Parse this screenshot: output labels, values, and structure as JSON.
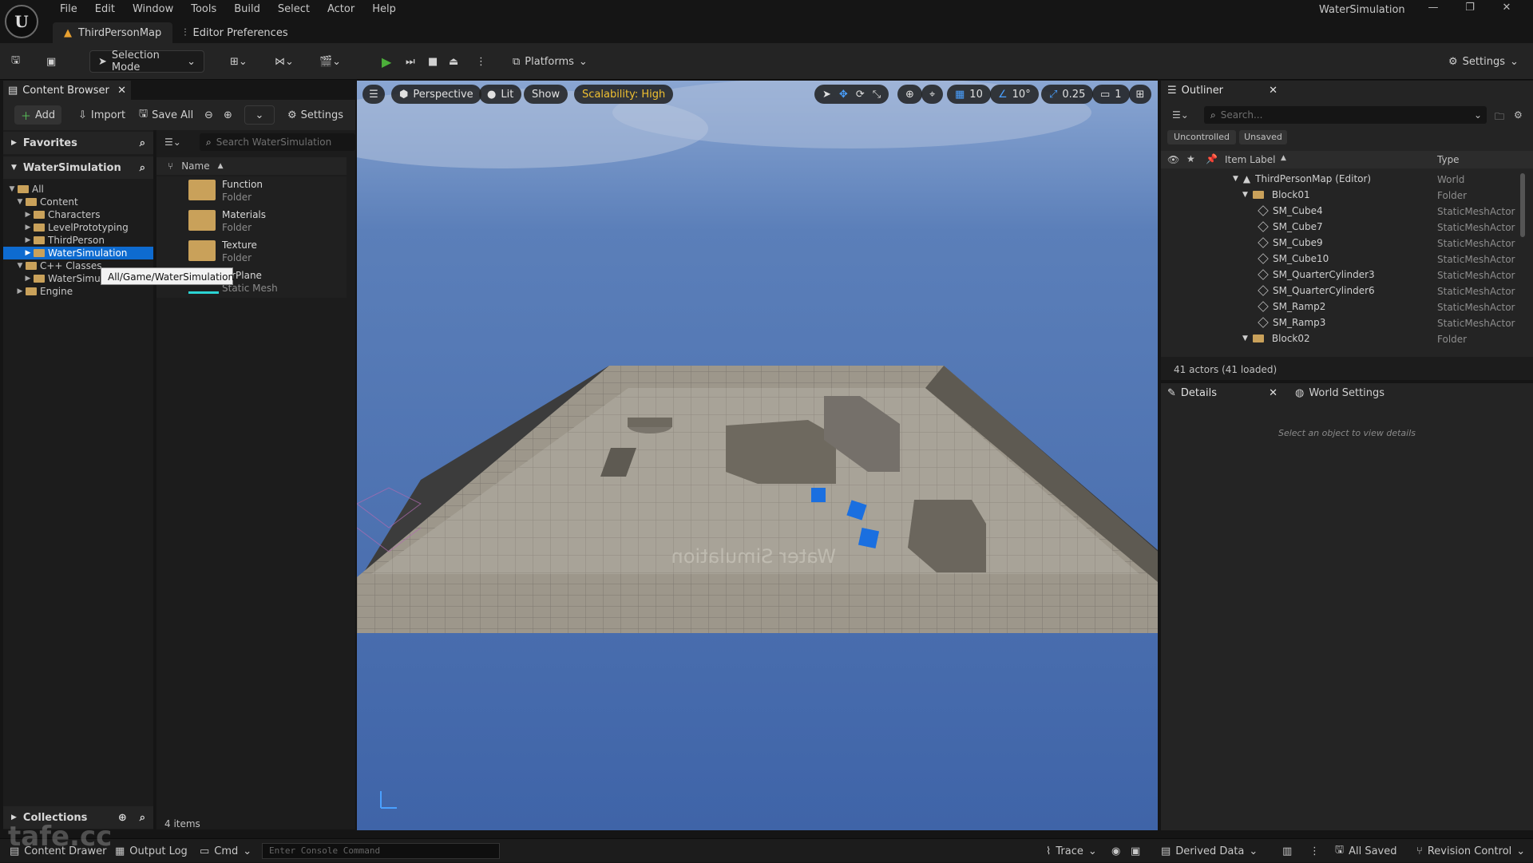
{
  "app": {
    "title": "WaterSimulation",
    "logo": "U"
  },
  "menu": [
    "File",
    "Edit",
    "Window",
    "Tools",
    "Build",
    "Select",
    "Actor",
    "Help"
  ],
  "tabs": [
    {
      "label": "ThirdPersonMap"
    },
    {
      "label": "Editor Preferences"
    }
  ],
  "toolbar": {
    "selection_mode": "Selection Mode",
    "platforms": "Platforms",
    "settings": "Settings"
  },
  "content_browser": {
    "tab_label": "Content Browser",
    "add": "Add",
    "import": "Import",
    "save_all": "Save All",
    "settings": "Settings",
    "favorites": "Favorites",
    "root": "WaterSimulation",
    "search_placeholder": "Search WaterSimulation",
    "name_col": "Name",
    "tree": [
      "All",
      "Content",
      "Characters",
      "LevelPrototyping",
      "ThirdPerson",
      "WaterSimulation",
      "C++ Classes",
      "WaterSimu",
      "Engine"
    ],
    "assets": [
      {
        "name": "Function",
        "type": "Folder"
      },
      {
        "name": "Materials",
        "type": "Folder"
      },
      {
        "name": "Texture",
        "type": "Folder"
      },
      {
        "name": "terPlane",
        "type": "Static Mesh"
      }
    ],
    "tooltip": "All/Game/WaterSimulation",
    "collections": "Collections",
    "item_count": "4 items"
  },
  "viewport": {
    "perspective": "Perspective",
    "lit": "Lit",
    "show": "Show",
    "scalability": "Scalability: High",
    "grid": "10",
    "angle": "10°",
    "scale": "0.25",
    "camera": "1",
    "floor_text": "Water Simulation"
  },
  "outliner": {
    "tab_label": "Outliner",
    "search_placeholder": "Search...",
    "uncontrolled": "Uncontrolled",
    "unsaved": "Unsaved",
    "col_label": "Item Label",
    "col_type": "Type",
    "rows": [
      {
        "label": "ThirdPersonMap (Editor)",
        "type": "World"
      },
      {
        "label": "Block01",
        "type": "Folder"
      },
      {
        "label": "SM_Cube4",
        "type": "StaticMeshActor"
      },
      {
        "label": "SM_Cube7",
        "type": "StaticMeshActor"
      },
      {
        "label": "SM_Cube9",
        "type": "StaticMeshActor"
      },
      {
        "label": "SM_Cube10",
        "type": "StaticMeshActor"
      },
      {
        "label": "SM_QuarterCylinder3",
        "type": "StaticMeshActor"
      },
      {
        "label": "SM_QuarterCylinder6",
        "type": "StaticMeshActor"
      },
      {
        "label": "SM_Ramp2",
        "type": "StaticMeshActor"
      },
      {
        "label": "SM_Ramp3",
        "type": "StaticMeshActor"
      },
      {
        "label": "Block02",
        "type": "Folder"
      }
    ],
    "footer": "41 actors (41 loaded)"
  },
  "details": {
    "tab_label": "Details",
    "world_settings": "World Settings",
    "empty": "Select an object to view details"
  },
  "statusbar": {
    "content_drawer": "Content Drawer",
    "output_log": "Output Log",
    "cmd": "Cmd",
    "console_placeholder": "Enter Console Command",
    "trace": "Trace",
    "derived_data": "Derived Data",
    "all_saved": "All Saved",
    "revision_control": "Revision Control"
  },
  "watermark": "tafe.cc"
}
